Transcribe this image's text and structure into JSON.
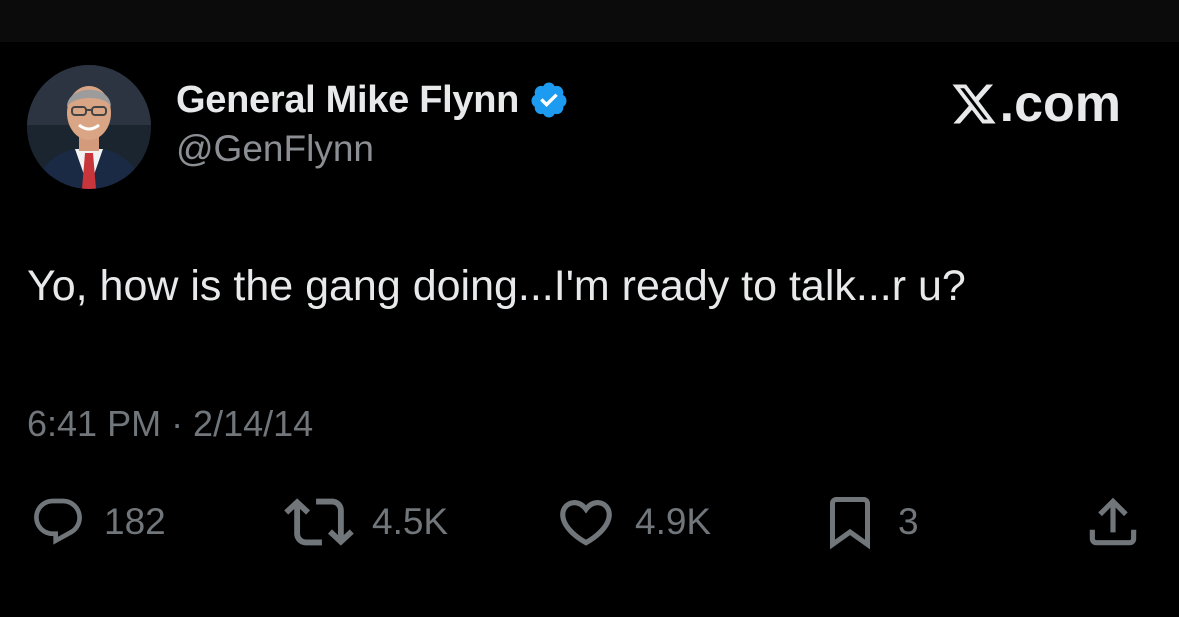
{
  "author": {
    "display_name": "General Mike Flynn",
    "handle": "@GenFlynn",
    "verified": true,
    "avatar": "profile-photo"
  },
  "site": {
    "logo_text": ".com",
    "logo_icon": "x-logo-icon"
  },
  "tweet": {
    "text": "Yo, how is the gang doing...I'm ready to talk...r u?",
    "timestamp": "6:41 PM · 2/14/14"
  },
  "actions": {
    "replies": "182",
    "reposts": "4.5K",
    "likes": "4.9K",
    "bookmarks": "3",
    "icons": [
      "reply-icon",
      "repost-icon",
      "like-icon",
      "bookmark-icon",
      "share-icon"
    ]
  },
  "colors": {
    "background": "#000000",
    "text_primary": "#e7e9ea",
    "text_secondary": "#71767b",
    "verified_blue": "#1d9bf0"
  }
}
